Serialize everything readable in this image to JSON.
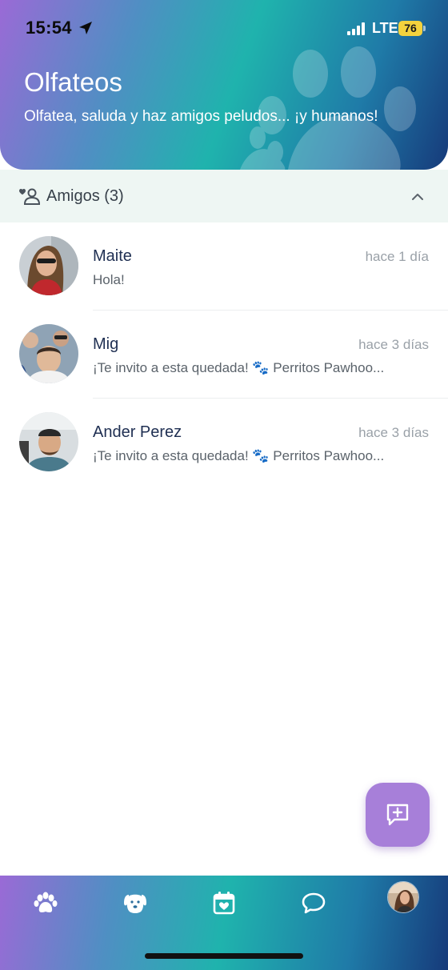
{
  "status_bar": {
    "time": "15:54",
    "network": "LTE",
    "battery": "76"
  },
  "header": {
    "title": "Olfateos",
    "subtitle": "Olfatea, saluda y haz amigos peludos... ¡y humanos!"
  },
  "friends_section": {
    "label": "Amigos (3)",
    "icon": "friends-heart-icon",
    "collapse_icon": "chevron-up-icon"
  },
  "chats": [
    {
      "name": "Maite",
      "time": "hace 1 día",
      "message": "Hola!"
    },
    {
      "name": "Mig",
      "time": "hace 3 días",
      "message": "¡Te invito a esta quedada! 🐾 Perritos Pawhoo..."
    },
    {
      "name": "Ander Perez",
      "time": "hace 3 días",
      "message": "¡Te invito a esta quedada! 🐾 Perritos Pawhoo..."
    }
  ],
  "fab": {
    "icon": "new-message-icon"
  },
  "bottom_nav": {
    "items": [
      "paw-icon",
      "dog-icon",
      "calendar-heart-icon",
      "chat-bubble-icon",
      "profile-avatar"
    ]
  },
  "colors": {
    "accent": "#a77fd9",
    "teal": "#1fb3ad",
    "navy": "#163a7a",
    "section_bg": "#eef6f3"
  }
}
